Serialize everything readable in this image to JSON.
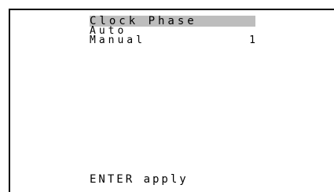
{
  "menu": {
    "title": "Clock Phase",
    "items": [
      {
        "label": "Auto",
        "value": ""
      },
      {
        "label": "Manual",
        "value": "1"
      }
    ]
  },
  "footer": {
    "hint": "ENTER apply"
  },
  "colors": {
    "background": "#ffffff",
    "text": "#000000",
    "highlight": "#bdbdbd"
  }
}
